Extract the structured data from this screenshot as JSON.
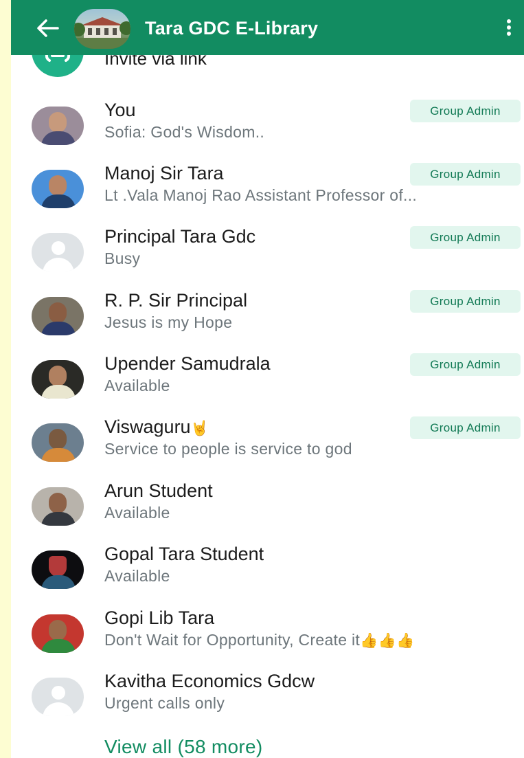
{
  "appbar": {
    "title": "Tara GDC E-Library",
    "back_icon": "arrow-left-icon",
    "menu_icon": "more-vertical-icon"
  },
  "invite": {
    "label": "Invite via link",
    "icon": "link-icon"
  },
  "members": [
    {
      "name": "You",
      "status": "Sofia: God's Wisdom..",
      "badge": "Group Admin"
    },
    {
      "name": "Manoj Sir Tara",
      "status": "Lt .Vala Manoj Rao Assistant Professor of...",
      "badge": "Group Admin"
    },
    {
      "name": "Principal Tara Gdc",
      "status": "Busy",
      "badge": "Group Admin"
    },
    {
      "name": "R. P. Sir Principal",
      "status": "Jesus is my Hope",
      "badge": "Group Admin"
    },
    {
      "name": "Upender Samudrala",
      "status": "Available",
      "badge": "Group Admin"
    },
    {
      "name": "Viswaguru",
      "name_emoji": "🤘",
      "status": "Service to people is service to god",
      "badge": "Group Admin"
    },
    {
      "name": "Arun Student",
      "status": "Available"
    },
    {
      "name": "Gopal Tara Student",
      "status": "Available"
    },
    {
      "name": "Gopi Lib Tara",
      "status": "Don't Wait for Opportunity, Create it",
      "status_emoji": "👍👍👍"
    },
    {
      "name": "Kavitha Economics Gdcw",
      "status": "Urgent calls only"
    }
  ],
  "view_all": "View all (58 more)",
  "colors": {
    "header": "#128c61",
    "badge_bg": "#e2f6ee",
    "badge_text": "#127a55",
    "accent": "#128c61",
    "outer_bg": "#fdfdd2"
  }
}
